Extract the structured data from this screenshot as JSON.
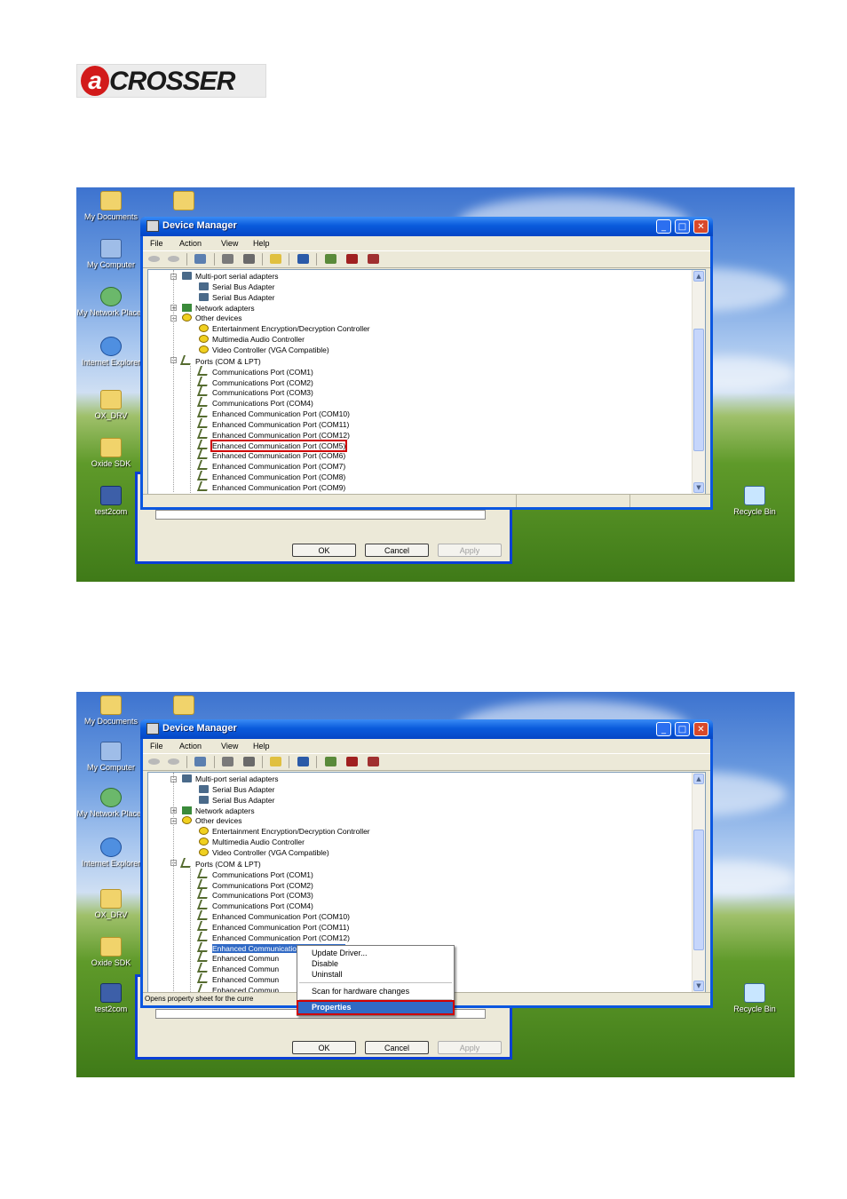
{
  "brand": {
    "logo_letter": "a",
    "logo_text": "CROSSER"
  },
  "desktop_icons": [
    {
      "label": "My Documents",
      "glyph": "folder"
    },
    {
      "label": "My Computer",
      "glyph": "pc"
    },
    {
      "label": "My Network Places",
      "glyph": "net"
    },
    {
      "label": "Internet Explorer",
      "glyph": "ie"
    },
    {
      "label": "OX_DRV",
      "glyph": "folder"
    },
    {
      "label": "Oxide SDK",
      "glyph": "folder"
    },
    {
      "label": "test2com",
      "glyph": "bld"
    }
  ],
  "recycle_bin": "Recycle Bin",
  "window": {
    "title": "Device Manager",
    "controls": {
      "minimize": "_",
      "maximize": "□",
      "close": "✕"
    },
    "menu": [
      "File",
      "Action",
      "View",
      "Help"
    ]
  },
  "tree": [
    {
      "label": "Multi-port serial adapters",
      "level": 0,
      "exp": "−",
      "icon": "hw"
    },
    {
      "label": "Serial Bus Adapter",
      "level": 1,
      "icon": "hw"
    },
    {
      "label": "Serial Bus Adapter",
      "level": 1,
      "icon": "hw"
    },
    {
      "label": "Network adapters",
      "level": 0,
      "exp": "+",
      "icon": "net"
    },
    {
      "label": "Other devices",
      "level": 0,
      "exp": "−",
      "icon": "q"
    },
    {
      "label": "Entertainment Encryption/Decryption Controller",
      "level": 1,
      "icon": "q"
    },
    {
      "label": "Multimedia Audio Controller",
      "level": 1,
      "icon": "q"
    },
    {
      "label": "Video Controller (VGA Compatible)",
      "level": 1,
      "icon": "q"
    },
    {
      "label": "Ports (COM & LPT)",
      "level": 0,
      "exp": "−",
      "icon": "port"
    },
    {
      "label": "Communications Port (COM1)",
      "level": 1,
      "icon": "port"
    },
    {
      "label": "Communications Port (COM2)",
      "level": 1,
      "icon": "port"
    },
    {
      "label": "Communications Port (COM3)",
      "level": 1,
      "icon": "port"
    },
    {
      "label": "Communications Port (COM4)",
      "level": 1,
      "icon": "port"
    },
    {
      "label": "Enhanced Communication Port (COM10)",
      "level": 1,
      "icon": "port"
    },
    {
      "label": "Enhanced Communication Port (COM11)",
      "level": 1,
      "icon": "port"
    },
    {
      "label": "Enhanced Communication Port (COM12)",
      "level": 1,
      "icon": "port"
    },
    {
      "label": "Enhanced Communication Port (COM5)",
      "level": 1,
      "icon": "port",
      "selected": true
    },
    {
      "label": "Enhanced Communication Port (COM6)",
      "level": 1,
      "icon": "port"
    },
    {
      "label": "Enhanced Communication Port (COM7)",
      "level": 1,
      "icon": "port"
    },
    {
      "label": "Enhanced Communication Port (COM8)",
      "level": 1,
      "icon": "port"
    },
    {
      "label": "Enhanced Communication Port (COM9)",
      "level": 1,
      "icon": "port"
    }
  ],
  "tree2_truncated": [
    "Enhanced Commun",
    "Enhanced Commun",
    "Enhanced Commun",
    "Enhanced Commun"
  ],
  "dialog_buttons": {
    "ok": "OK",
    "cancel": "Cancel",
    "apply": "Apply"
  },
  "context_menu": {
    "items": [
      "Update Driver...",
      "Disable",
      "Uninstall"
    ],
    "scan": "Scan for hardware changes",
    "properties": "Properties"
  },
  "status_text_2": "Opens property sheet for the curre"
}
